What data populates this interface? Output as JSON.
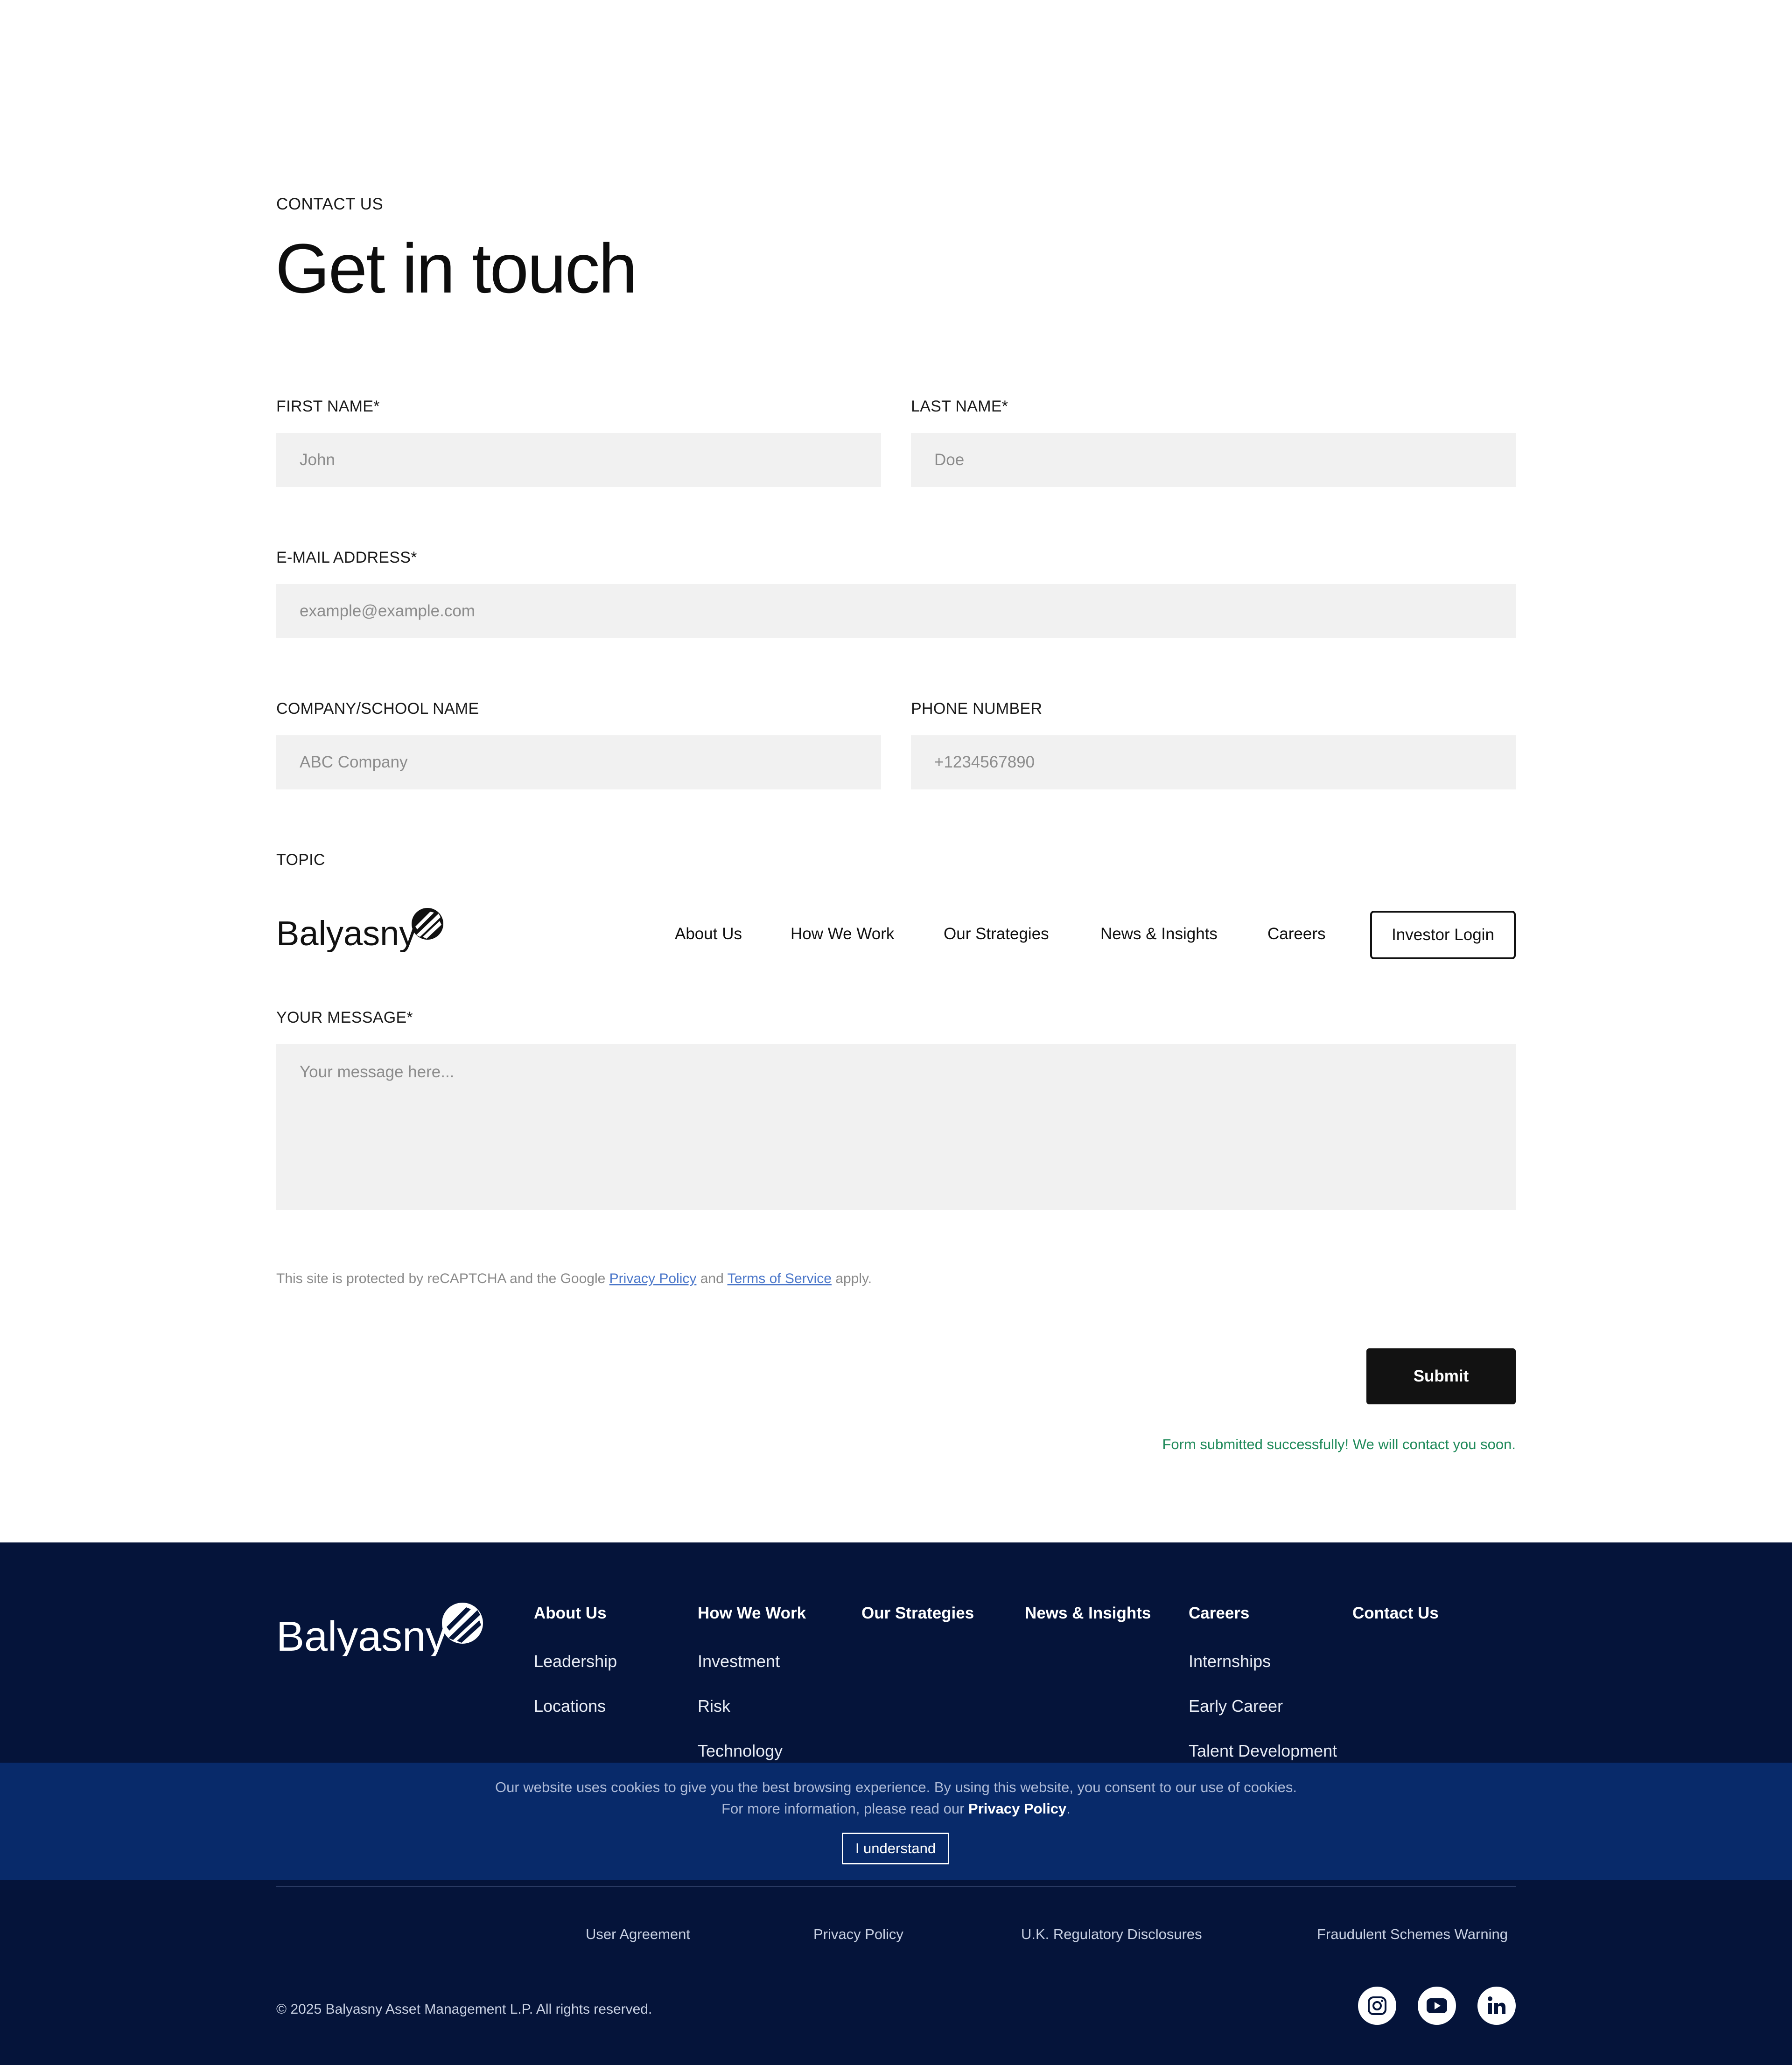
{
  "contact": {
    "eyebrow": "CONTACT US",
    "title": "Get in touch",
    "first_name": {
      "label": "FIRST NAME*",
      "placeholder": "John"
    },
    "last_name": {
      "label": "LAST NAME*",
      "placeholder": "Doe"
    },
    "email": {
      "label": "E-MAIL ADDRESS*",
      "placeholder": "example@example.com"
    },
    "company": {
      "label": "COMPANY/SCHOOL NAME",
      "placeholder": "ABC Company"
    },
    "phone": {
      "label": "PHONE NUMBER",
      "placeholder": "+1234567890"
    },
    "topic": {
      "label": "TOPIC"
    },
    "message": {
      "label": "YOUR MESSAGE*",
      "placeholder": "Your message here..."
    },
    "recaptcha": {
      "prefix": "This site is protected by reCAPTCHA and the Google ",
      "privacy": "Privacy Policy",
      "and": " and ",
      "terms": "Terms of Service",
      "suffix": " apply."
    },
    "submit_label": "Submit",
    "success_message": "Form submitted successfully! We will contact you soon."
  },
  "navbar": {
    "logo_text": "Balyasny",
    "items": [
      "About Us",
      "How We Work",
      "Our Strategies",
      "News & Insights",
      "Careers"
    ],
    "login_label": "Investor Login"
  },
  "footer": {
    "logo_text": "Balyasny",
    "columns": [
      {
        "heading": "About Us",
        "items": [
          "Leadership",
          "Locations"
        ]
      },
      {
        "heading": "How We Work",
        "items": [
          "Investment",
          "Risk",
          "Technology"
        ]
      },
      {
        "heading": "Our Strategies",
        "items": []
      },
      {
        "heading": "News & Insights",
        "items": []
      },
      {
        "heading": "Careers",
        "items": [
          "Internships",
          "Early Career",
          "Talent Development"
        ]
      },
      {
        "heading": "Contact Us",
        "items": []
      }
    ],
    "legal_links": [
      "User Agreement",
      "Privacy Policy",
      "U.K. Regulatory Disclosures",
      "Fraudulent Schemes Warning"
    ],
    "copyright": "© 2025 Balyasny Asset Management L.P. All rights reserved.",
    "social_icons": [
      "instagram-icon",
      "youtube-icon",
      "linkedin-icon"
    ]
  },
  "cookie_banner": {
    "line1": "Our website uses cookies to give you the best browsing experience. By using this website, you consent to our use of cookies.",
    "line2_prefix": "For more information, please read our ",
    "line2_link": "Privacy Policy",
    "line2_suffix": ".",
    "button_label": "I understand"
  },
  "colors": {
    "footer_bg": "#05143a",
    "cookie_bg": "#082a6a",
    "success": "#1f8a5a",
    "link": "#4a76c9",
    "field_bg": "#f1f1f1"
  }
}
